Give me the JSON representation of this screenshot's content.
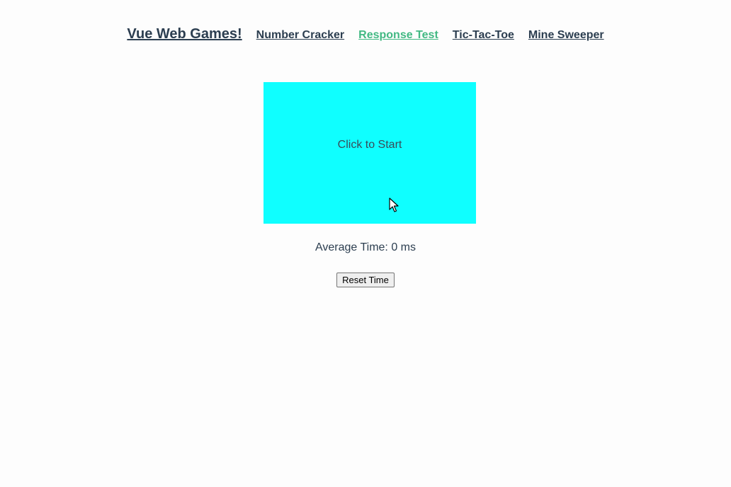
{
  "nav": {
    "brand": "Vue Web Games!",
    "links": [
      {
        "label": "Number Cracker",
        "active": false
      },
      {
        "label": "Response Test",
        "active": true
      },
      {
        "label": "Tic-Tac-Toe",
        "active": false
      },
      {
        "label": "Mine Sweeper",
        "active": false
      }
    ],
    "active_color": "#42b983",
    "text_color": "#2c3e50"
  },
  "game": {
    "prompt": "Click to Start",
    "box_color": "#0fffff"
  },
  "stats": {
    "average_label": "Average Time: 0 ms"
  },
  "controls": {
    "reset_label": "Reset Time"
  },
  "icons": {
    "cursor": "mouse-pointer-icon"
  }
}
